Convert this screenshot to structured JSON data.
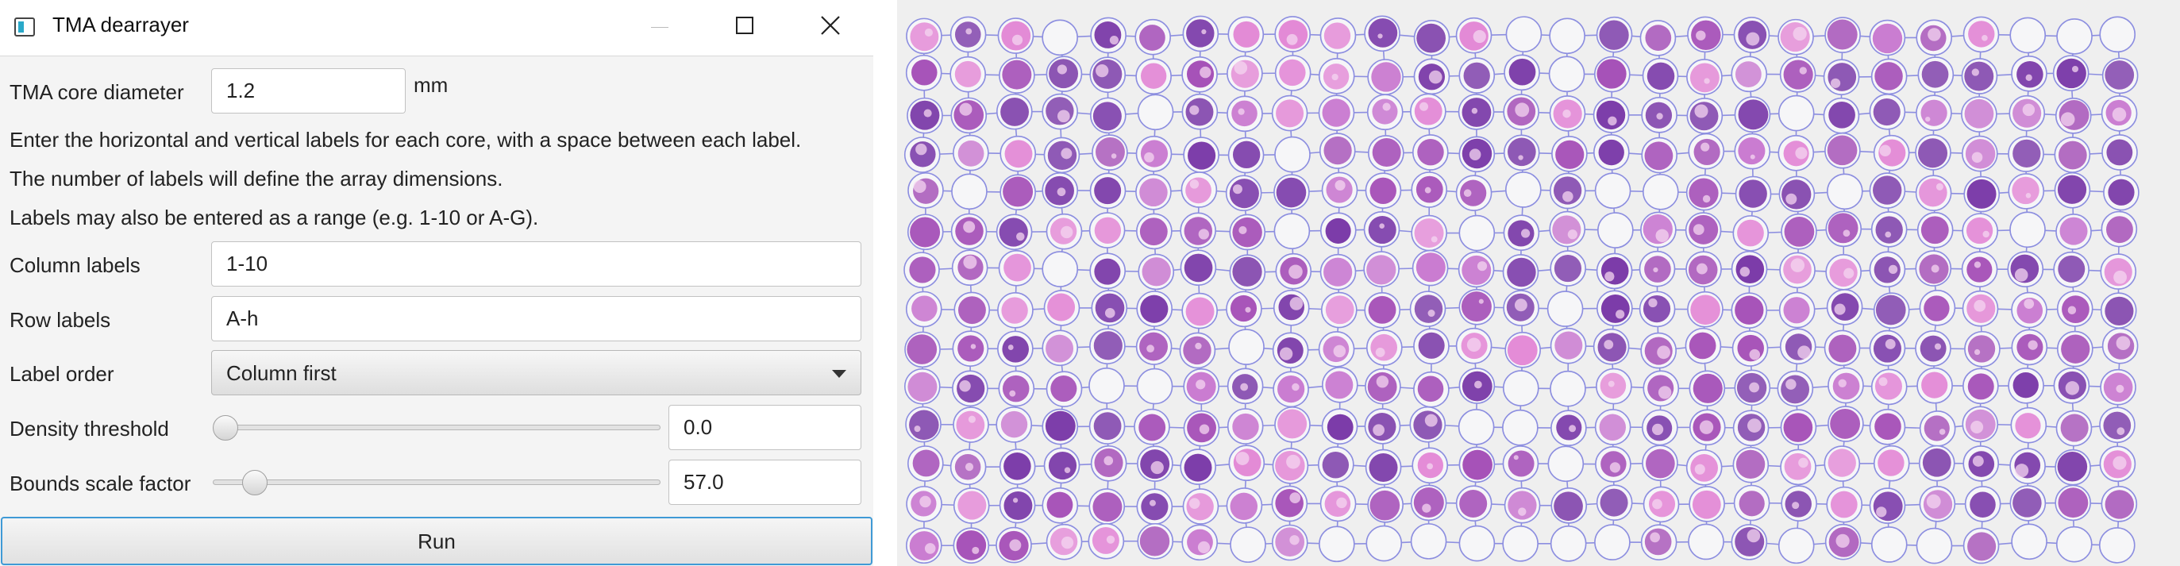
{
  "window": {
    "title": "TMA dearrayer",
    "controls": [
      "minimize",
      "maximize",
      "close"
    ]
  },
  "form": {
    "core_diameter": {
      "label": "TMA core diameter",
      "value": "1.2",
      "unit": "mm"
    },
    "instructions": [
      "Enter the horizontal and vertical labels for each core, with a space between each label.",
      "The number of labels will define the array dimensions.",
      "Labels may also be entered as a range (e.g. 1-10 or A-G)."
    ],
    "column_labels": {
      "label": "Column labels",
      "value": "1-10"
    },
    "row_labels": {
      "label": "Row labels",
      "value": "A-h"
    },
    "label_order": {
      "label": "Label order",
      "selected": "Column first"
    },
    "density_threshold": {
      "label": "Density threshold",
      "slider_fraction": 0.0,
      "value": "0.0"
    },
    "bounds_scale_factor": {
      "label": "Bounds scale factor",
      "slider_fraction": 0.07,
      "value": "57.0"
    }
  },
  "run_button": {
    "label": "Run"
  },
  "tma_image": {
    "grid": {
      "columns": 27,
      "rows": 14
    },
    "colors": {
      "background": "#efefef",
      "grid_line": "#8c8ee0",
      "stain_dark": "#7a3aa8",
      "stain_mid": "#a652b8",
      "stain_light": "#c97ad0",
      "stain_pink": "#e38ad6",
      "empty_core": "#f6f6f8"
    }
  },
  "icons": {
    "app": "app-icon",
    "minimize": "minimize-icon",
    "maximize": "maximize-icon",
    "close": "close-icon",
    "dropdown": "chevron-down-icon"
  }
}
